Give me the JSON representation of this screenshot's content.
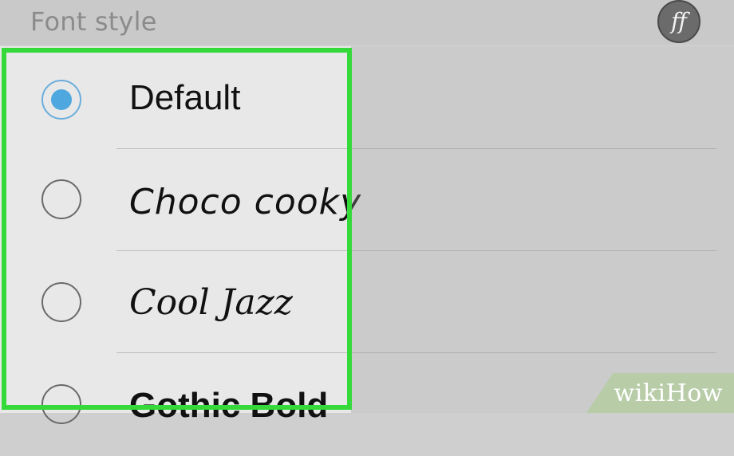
{
  "header": {
    "title": "Font style",
    "icon_label": "ff",
    "icon_name": "font-ff-icon"
  },
  "options": [
    {
      "label": "Default",
      "selected": true
    },
    {
      "label": "Choco cooky",
      "selected": false
    },
    {
      "label": "Cool Jazz",
      "selected": false
    },
    {
      "label": "Gothic Bold",
      "selected": false
    }
  ],
  "colors": {
    "highlight": "#35d93a",
    "radio_selected": "#4ea8df"
  },
  "watermark": {
    "text": "wikiHow"
  }
}
